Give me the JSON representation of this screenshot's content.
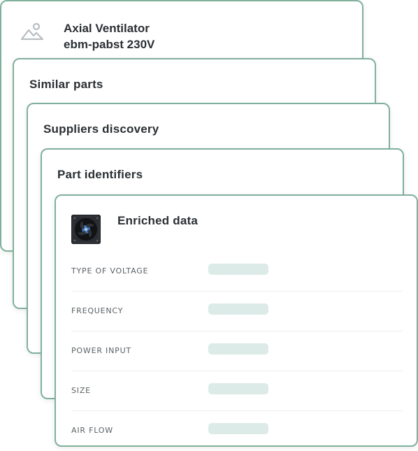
{
  "cards": {
    "product": {
      "name_line1": "Axial Ventilator",
      "name_line2": "ebm-pabst 230V",
      "icon": "image-placeholder-icon"
    },
    "similar_parts": {
      "title": "Similar parts"
    },
    "suppliers": {
      "title": "Suppliers discovery"
    },
    "identifiers": {
      "title": "Part identifiers"
    },
    "enriched": {
      "title": "Enriched data",
      "thumbnail": "fan-product-image",
      "rows": [
        {
          "label": "TYPE OF VOLTAGE"
        },
        {
          "label": "FREQUENCY"
        },
        {
          "label": "POWER INPUT"
        },
        {
          "label": "SIZE"
        },
        {
          "label": "AIR FLOW"
        }
      ]
    }
  },
  "colors": {
    "card_border": "#7fb09c",
    "skeleton": "#dcebe7",
    "text": "#2b2f33",
    "label": "#5b6166"
  }
}
